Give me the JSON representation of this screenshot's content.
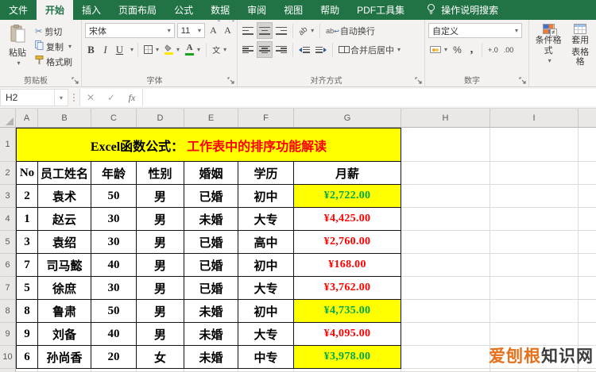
{
  "menubar": {
    "tabs": [
      {
        "label": "文件"
      },
      {
        "label": "开始"
      },
      {
        "label": "插入"
      },
      {
        "label": "页面布局"
      },
      {
        "label": "公式"
      },
      {
        "label": "数据"
      },
      {
        "label": "审阅"
      },
      {
        "label": "视图"
      },
      {
        "label": "帮助"
      },
      {
        "label": "PDF工具集"
      }
    ],
    "search_label": "操作说明搜索"
  },
  "ribbon": {
    "clipboard": {
      "group_label": "剪贴板",
      "paste": "粘贴",
      "cut": "剪切",
      "copy": "复制",
      "format_painter": "格式刷"
    },
    "font": {
      "group_label": "字体",
      "name": "宋体",
      "size": "11",
      "bold": "B",
      "italic": "I",
      "underline": "U",
      "grow": "A",
      "shrink": "A",
      "color_letter": "A",
      "phonetic": "文"
    },
    "alignment": {
      "group_label": "对齐方式",
      "wrap": "自动换行",
      "merge": "合并后居中"
    },
    "number": {
      "group_label": "数字",
      "format": "自定义",
      "percent": "%",
      "comma": ","
    },
    "styles": {
      "conditional": "条件格式",
      "format_table_line1": "套用",
      "format_table_line2": "表格格"
    }
  },
  "formula_bar": {
    "name_box": "H2",
    "cancel": "✕",
    "enter": "✓",
    "fx": "fx",
    "formula": ""
  },
  "grid": {
    "column_letters": [
      "A",
      "B",
      "C",
      "D",
      "E",
      "F",
      "G",
      "H",
      "I"
    ],
    "row_numbers": [
      "1",
      "2",
      "3",
      "4",
      "5",
      "6",
      "7",
      "8",
      "9",
      "10"
    ],
    "title": {
      "prefix": "Excel函数公式：",
      "emphasis": "工作表中的排序功能解读"
    },
    "header": [
      "No",
      "员工姓名",
      "年龄",
      "性别",
      "婚姻",
      "学历",
      "月薪"
    ],
    "data": [
      {
        "no": "2",
        "name": "袁术",
        "age": "50",
        "gender": "男",
        "marital": "已婚",
        "education": "初中",
        "salary": "¥2,722.00",
        "highlight": true
      },
      {
        "no": "1",
        "name": "赵云",
        "age": "30",
        "gender": "男",
        "marital": "未婚",
        "education": "大专",
        "salary": "¥4,425.00",
        "highlight": false
      },
      {
        "no": "3",
        "name": "袁绍",
        "age": "30",
        "gender": "男",
        "marital": "已婚",
        "education": "高中",
        "salary": "¥2,760.00",
        "highlight": false
      },
      {
        "no": "7",
        "name": "司马懿",
        "age": "40",
        "gender": "男",
        "marital": "已婚",
        "education": "初中",
        "salary": "¥168.00",
        "highlight": false
      },
      {
        "no": "5",
        "name": "徐庶",
        "age": "30",
        "gender": "男",
        "marital": "已婚",
        "education": "大专",
        "salary": "¥3,762.00",
        "highlight": false
      },
      {
        "no": "8",
        "name": "鲁肃",
        "age": "50",
        "gender": "男",
        "marital": "未婚",
        "education": "初中",
        "salary": "¥4,735.00",
        "highlight": true
      },
      {
        "no": "9",
        "name": "刘备",
        "age": "40",
        "gender": "男",
        "marital": "未婚",
        "education": "大专",
        "salary": "¥4,095.00",
        "highlight": false
      },
      {
        "no": "6",
        "name": "孙尚香",
        "age": "20",
        "gender": "女",
        "marital": "未婚",
        "education": "中专",
        "salary": "¥3,978.00",
        "highlight": true
      }
    ]
  },
  "watermark": {
    "orange": "爱刨根",
    "gray": "知识网"
  },
  "colors": {
    "excel_green": "#217346",
    "highlight_yellow": "#ffff00",
    "salary_red": "#fe0000",
    "salary_green": "#00a651",
    "watermark_orange": "#e8701a"
  }
}
